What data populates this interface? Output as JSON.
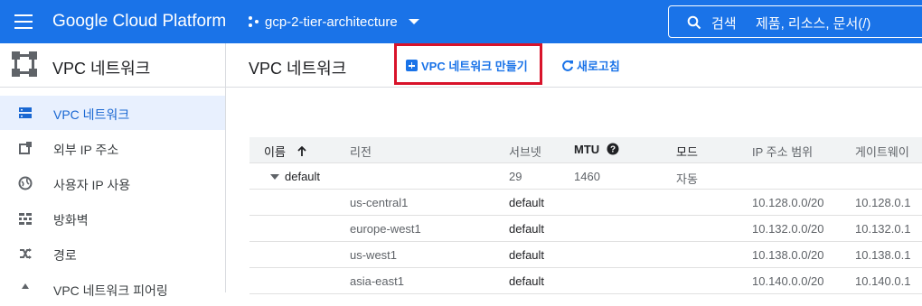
{
  "topbar": {
    "brand": "Google Cloud Platform",
    "project": "gcp-2-tier-architecture",
    "search_label": "검색",
    "search_placeholder": "제품, 리소스, 문서(/)"
  },
  "sidebar": {
    "title": "VPC 네트워크",
    "items": [
      {
        "label": "VPC 네트워크",
        "icon": "vpc-network-icon",
        "active": true
      },
      {
        "label": "외부 IP 주소",
        "icon": "external-ip-icon"
      },
      {
        "label": "사용자 IP 사용",
        "icon": "globe-icon"
      },
      {
        "label": "방화벽",
        "icon": "firewall-icon"
      },
      {
        "label": "경로",
        "icon": "routes-icon"
      },
      {
        "label": "VPC 네트워크 피어링",
        "icon": "peering-icon"
      }
    ]
  },
  "main": {
    "title": "VPC 네트워크",
    "create_label": "VPC 네트워크 만들기",
    "refresh_label": "새로고침"
  },
  "table": {
    "columns": [
      "이름",
      "리전",
      "서브넷",
      "MTU",
      "모드",
      "IP 주소 범위",
      "게이트웨이"
    ],
    "network": {
      "name": "default",
      "subnets": "29",
      "mtu": "1460",
      "mode": "자동"
    },
    "subnets": [
      {
        "region": "us-central1",
        "name": "default",
        "range": "10.128.0.0/20",
        "gateway": "10.128.0.1"
      },
      {
        "region": "europe-west1",
        "name": "default",
        "range": "10.132.0.0/20",
        "gateway": "10.132.0.1"
      },
      {
        "region": "us-west1",
        "name": "default",
        "range": "10.138.0.0/20",
        "gateway": "10.138.0.1"
      },
      {
        "region": "asia-east1",
        "name": "default",
        "range": "10.140.0.0/20",
        "gateway": "10.140.0.1"
      }
    ]
  },
  "colors": {
    "accent": "#1a73e8",
    "highlight": "#d8132a"
  }
}
